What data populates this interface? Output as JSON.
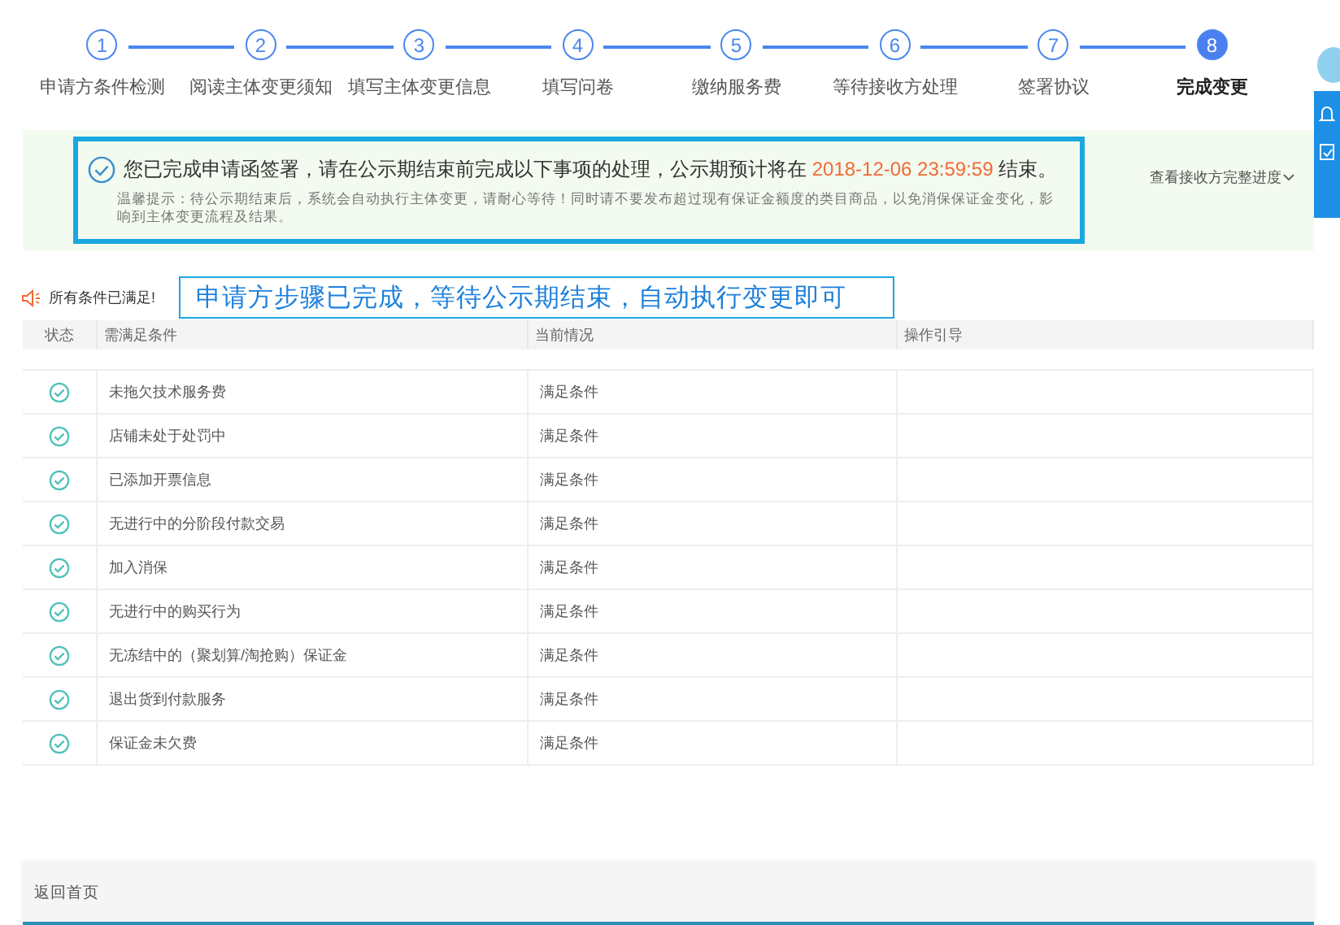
{
  "steps": [
    {
      "number": "1",
      "label": "申请方条件检测",
      "selected": false
    },
    {
      "number": "2",
      "label": "阅读主体变更须知",
      "selected": false
    },
    {
      "number": "3",
      "label": "填写主体变更信息",
      "selected": false
    },
    {
      "number": "4",
      "label": "填写问卷",
      "selected": false
    },
    {
      "number": "5",
      "label": "缴纳服务费",
      "selected": false
    },
    {
      "number": "6",
      "label": "等待接收方处理",
      "selected": false
    },
    {
      "number": "7",
      "label": "签署协议",
      "selected": false
    },
    {
      "number": "8",
      "label": "完成变更",
      "selected": true
    }
  ],
  "notice": {
    "message_start": "您已完成申请函签署，请在公示期结束前完成以下事项的处理，公示期预计将在",
    "deadline": "2018-12-06 23:59:59",
    "message_end": "结束。",
    "tip": "温馨提示：待公示期结束后，系统会自动执行主体变更，请耐心等待！同时请不要发布超过现有保证金额度的类目商品，以免消保保证金变化，影响到主体变更流程及结果。",
    "progress_link": "查看接收方完整进度"
  },
  "conditions_status": "所有条件已满足!",
  "annotation": "申请方步骤已完成，等待公示期结束，自动执行变更即可",
  "table": {
    "columns": [
      "状态",
      "需满足条件",
      "当前情况",
      "操作引导"
    ],
    "rows": [
      {
        "condition": "未拖欠技术服务费",
        "current": "满足条件",
        "satisfied": true
      },
      {
        "condition": "店铺未处于处罚中",
        "current": "满足条件",
        "satisfied": true
      },
      {
        "condition": "已添加开票信息",
        "current": "满足条件",
        "satisfied": true
      },
      {
        "condition": "无进行中的分阶段付款交易",
        "current": "满足条件",
        "satisfied": true
      },
      {
        "condition": "加入消保",
        "current": "满足条件",
        "satisfied": true
      },
      {
        "condition": "无进行中的购买行为",
        "current": "满足条件",
        "satisfied": true
      },
      {
        "condition": "无冻结中的（聚划算/淘抢购）保证金",
        "current": "满足条件",
        "satisfied": true
      },
      {
        "condition": "退出货到付款服务",
        "current": "满足条件",
        "satisfied": true
      },
      {
        "condition": "保证金未欠费",
        "current": "满足条件",
        "satisfied": true
      }
    ]
  },
  "footer": {
    "back_link": "返回首页"
  }
}
